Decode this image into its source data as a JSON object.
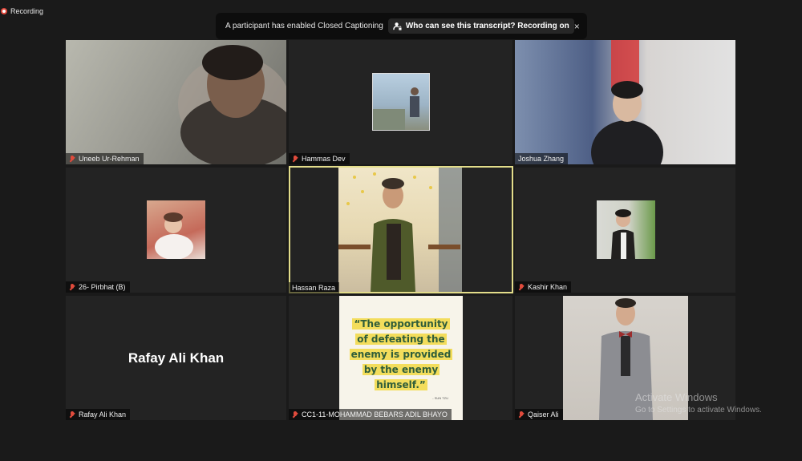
{
  "recording": {
    "label": "Recording"
  },
  "banner": {
    "message": "A participant has enabled Closed Captioning",
    "who_label": "Who can see this transcript? Recording on",
    "close": "×"
  },
  "participants": [
    {
      "name": "Uneeb Ur-Rehman"
    },
    {
      "name": "Hammas Dev"
    },
    {
      "name": "Joshua Zhang"
    },
    {
      "name": "26- Pirbhat (B)"
    },
    {
      "name": "Hassan Raza"
    },
    {
      "name": "Kashir Khan"
    },
    {
      "name": "Rafay Ali Khan",
      "display_name": "Rafay Ali Khan"
    },
    {
      "name": "CC1-11-MOHAMMAD BEBARS ADIL BHAYO",
      "quote": {
        "line1": "“The opportunity",
        "line2": "of defeating the",
        "line3": "enemy is provided",
        "line4": "by the enemy",
        "line5": "himself.”",
        "source": "- SUN TZU"
      }
    },
    {
      "name": "Qaiser Ali"
    }
  ],
  "watermark": {
    "title": "Activate Windows",
    "subtitle": "Go to Settings to activate Windows."
  },
  "colors": {
    "active_speaker": "#e3dd8a",
    "muted_mic": "#e04b3c"
  }
}
